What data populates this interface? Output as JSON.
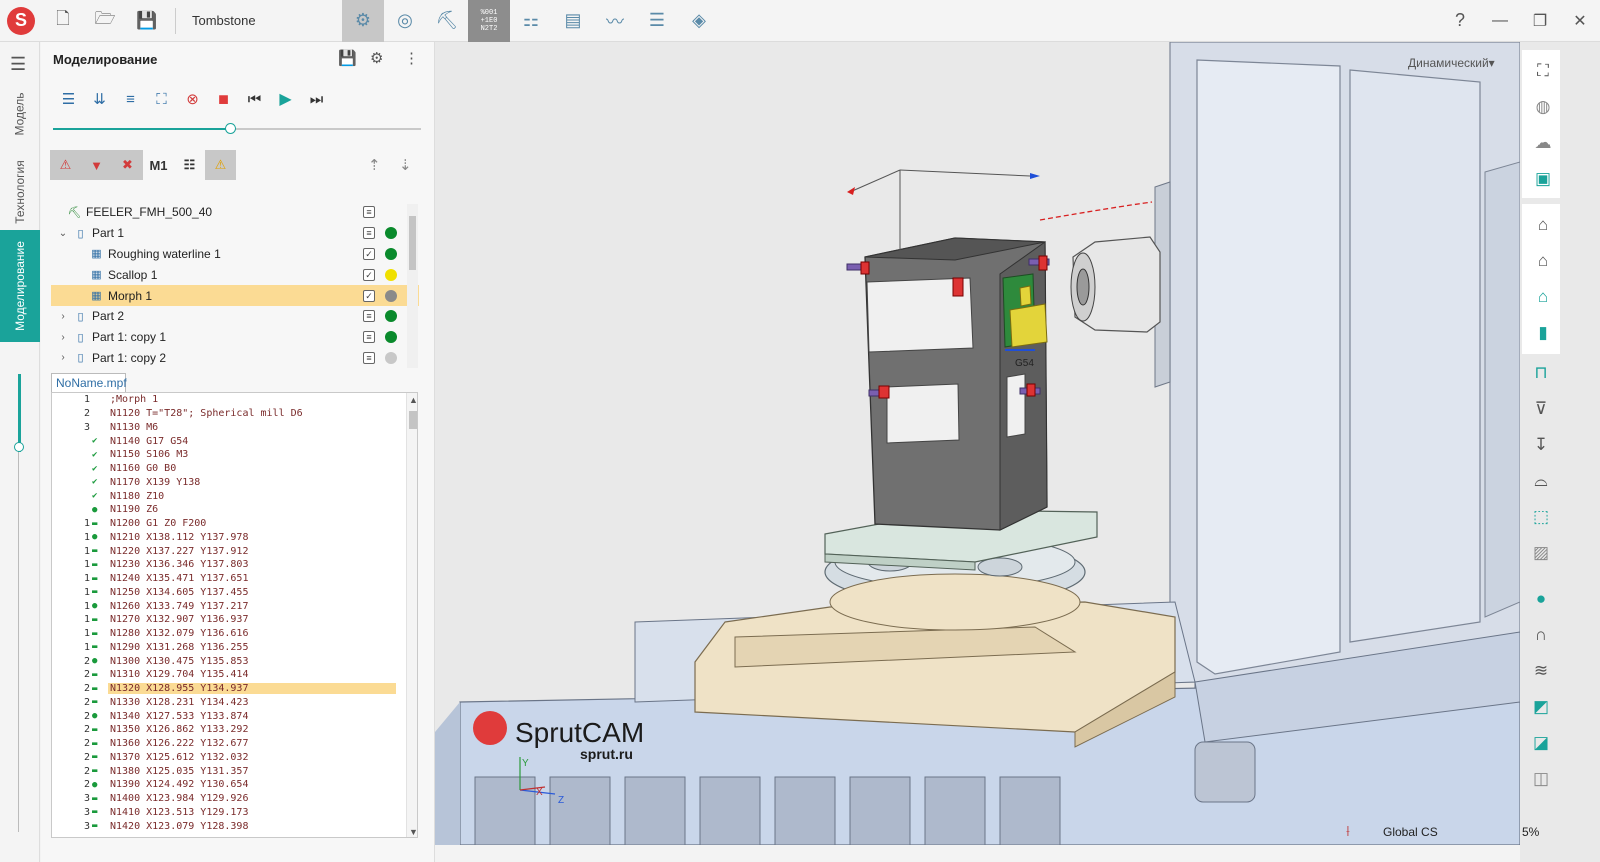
{
  "titlebar": {
    "project_name": "Tombstone",
    "help_label": "?",
    "nc_box_text": "%001\n+1E0\nN2T2"
  },
  "left_rail": {
    "tabs": [
      "Модель",
      "Технология",
      "Моделирование"
    ],
    "active_tab": "Моделирование"
  },
  "panel": {
    "title": "Моделирование",
    "speed_fraction": 0.48,
    "filter_m1_label": "M1"
  },
  "tree": {
    "items": [
      {
        "label": "FEELER_FMH_500_40",
        "level": 0,
        "chevron": "",
        "icon": "machine",
        "check": "doc",
        "status": ""
      },
      {
        "label": "Part 1",
        "level": 1,
        "chevron": "down",
        "icon": "part",
        "check": "doc",
        "status": "#0a8a2c"
      },
      {
        "label": "Roughing waterline 1",
        "level": 2,
        "chevron": "",
        "icon": "op",
        "check": "checked",
        "status": "#0a8a2c"
      },
      {
        "label": "Scallop 1",
        "level": 2,
        "chevron": "",
        "icon": "op",
        "check": "checked",
        "status": "#f0e000"
      },
      {
        "label": "Morph 1",
        "level": 2,
        "chevron": "",
        "icon": "op",
        "check": "checked",
        "status": "#8a8a8a",
        "selected": true
      },
      {
        "label": "Part 2",
        "level": 1,
        "chevron": "right",
        "icon": "part",
        "check": "doc",
        "status": "#0a8a2c"
      },
      {
        "label": "Part 1: copy 1",
        "level": 1,
        "chevron": "right",
        "icon": "part",
        "check": "doc",
        "status": "#0a8a2c"
      },
      {
        "label": "Part 1: copy 2",
        "level": 1,
        "chevron": "right",
        "icon": "part",
        "check": "doc",
        "status": "#c8c8c8"
      }
    ]
  },
  "code": {
    "file_name": "NoName.mpf",
    "lines": [
      {
        "num": "1",
        "mark": "",
        "text": ";Morph 1"
      },
      {
        "num": "2",
        "mark": "",
        "text": "N1120 T=\"T28\"; Spherical mill D6"
      },
      {
        "num": "3",
        "mark": "",
        "text": "N1130 M6"
      },
      {
        "num": "",
        "mark": "✔",
        "text": "N1140 G17 G54"
      },
      {
        "num": "",
        "mark": "✔",
        "text": "N1150 S106 M3"
      },
      {
        "num": "",
        "mark": "✔",
        "text": "N1160 G0 B0"
      },
      {
        "num": "",
        "mark": "✔",
        "text": "N1170 X139 Y138"
      },
      {
        "num": "",
        "mark": "✔",
        "text": "N1180 Z10"
      },
      {
        "num": "",
        "mark": "●",
        "text": "N1190 Z6"
      },
      {
        "num": "1",
        "mark": "▬",
        "text": "N1200 G1 Z0 F200"
      },
      {
        "num": "1",
        "mark": "●",
        "text": "N1210 X138.112 Y137.978"
      },
      {
        "num": "1",
        "mark": "▬",
        "text": "N1220 X137.227 Y137.912"
      },
      {
        "num": "1",
        "mark": "▬",
        "text": "N1230 X136.346 Y137.803"
      },
      {
        "num": "1",
        "mark": "▬",
        "text": "N1240 X135.471 Y137.651"
      },
      {
        "num": "1",
        "mark": "▬",
        "text": "N1250 X134.605 Y137.455"
      },
      {
        "num": "1",
        "mark": "●",
        "text": "N1260 X133.749 Y137.217"
      },
      {
        "num": "1",
        "mark": "▬",
        "text": "N1270 X132.907 Y136.937"
      },
      {
        "num": "1",
        "mark": "▬",
        "text": "N1280 X132.079 Y136.616"
      },
      {
        "num": "1",
        "mark": "▬",
        "text": "N1290 X131.268 Y136.255"
      },
      {
        "num": "2",
        "mark": "●",
        "text": "N1300 X130.475 Y135.853"
      },
      {
        "num": "2",
        "mark": "▬",
        "text": "N1310 X129.704 Y135.414"
      },
      {
        "num": "2",
        "mark": "▬",
        "text": "N1320 X128.955 Y134.937",
        "highlight": true
      },
      {
        "num": "2",
        "mark": "▬",
        "text": "N1330 X128.231 Y134.423"
      },
      {
        "num": "2",
        "mark": "●",
        "text": "N1340 X127.533 Y133.874"
      },
      {
        "num": "2",
        "mark": "▬",
        "text": "N1350 X126.862 Y133.292"
      },
      {
        "num": "2",
        "mark": "▬",
        "text": "N1360 X126.222 Y132.677"
      },
      {
        "num": "2",
        "mark": "▬",
        "text": "N1370 X125.612 Y132.032"
      },
      {
        "num": "2",
        "mark": "▬",
        "text": "N1380 X125.035 Y131.357"
      },
      {
        "num": "2",
        "mark": "●",
        "text": "N1390 X124.492 Y130.654"
      },
      {
        "num": "3",
        "mark": "▬",
        "text": "N1400 X123.984 Y129.926"
      },
      {
        "num": "3",
        "mark": "▬",
        "text": "N1410 X123.513 Y129.173"
      },
      {
        "num": "3",
        "mark": "▬",
        "text": "N1420 X123.079 Y128.398"
      }
    ]
  },
  "viewport": {
    "view_mode": "Динамический",
    "brand_name": "SprutCAM",
    "brand_url": "sprut.ru",
    "workoffset_label": "G54",
    "axis_y": "Y",
    "axis_x": "X",
    "axis_z": "Z"
  },
  "status": {
    "cs_label": "Global CS",
    "zoom": "5%"
  },
  "colors": {
    "accent": "#1aa39a",
    "selection": "#fbdb94",
    "brand_red": "#e03b3b"
  }
}
